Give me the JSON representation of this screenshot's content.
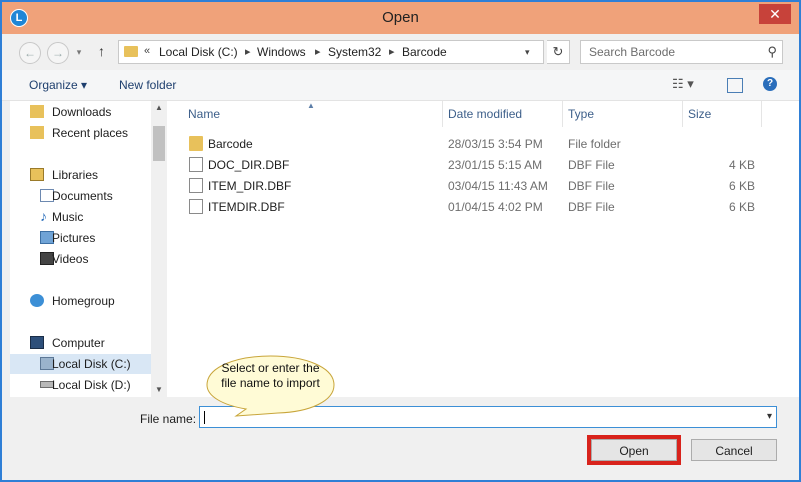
{
  "window": {
    "title": "Open",
    "close_label": "✕",
    "app_icon": "L"
  },
  "navigation": {
    "back_glyph": "←",
    "forward_glyph": "→",
    "up_glyph": "↑",
    "breadcrumb": [
      "Local Disk (C:)",
      "Windows",
      "System32",
      "Barcode"
    ],
    "overflow": "«",
    "refresh_glyph": "↻"
  },
  "search": {
    "placeholder": "Search Barcode",
    "icon": "search-icon"
  },
  "toolbar": {
    "organize_label": "Organize ▾",
    "new_folder_label": "New folder",
    "view_glyph": "☷ ▾",
    "help_glyph": "?"
  },
  "sidebar": {
    "items": [
      {
        "label": "Downloads",
        "icon": "downloads-icon"
      },
      {
        "label": "Recent places",
        "icon": "recent-places-icon"
      },
      {
        "label": "Libraries",
        "icon": "libraries-icon"
      },
      {
        "label": "Documents",
        "icon": "documents-icon"
      },
      {
        "label": "Music",
        "icon": "music-icon"
      },
      {
        "label": "Pictures",
        "icon": "pictures-icon"
      },
      {
        "label": "Videos",
        "icon": "videos-icon"
      },
      {
        "label": "Homegroup",
        "icon": "homegroup-icon"
      },
      {
        "label": "Computer",
        "icon": "computer-icon"
      },
      {
        "label": "Local Disk (C:)",
        "icon": "drive-c-icon",
        "selected": true
      },
      {
        "label": "Local Disk (D:)",
        "icon": "drive-d-icon"
      }
    ]
  },
  "columns": {
    "name": "Name",
    "date": "Date modified",
    "type": "Type",
    "size": "Size"
  },
  "files": [
    {
      "name": "Barcode",
      "date": "28/03/15 3:54 PM",
      "type": "File folder",
      "size": "",
      "kind": "folder"
    },
    {
      "name": "DOC_DIR.DBF",
      "date": "23/01/15 5:15 AM",
      "type": "DBF File",
      "size": "4 KB",
      "kind": "file"
    },
    {
      "name": "ITEM_DIR.DBF",
      "date": "03/04/15 11:43 AM",
      "type": "DBF File",
      "size": "6 KB",
      "kind": "file"
    },
    {
      "name": "ITEMDIR.DBF",
      "date": "01/04/15 4:02 PM",
      "type": "DBF File",
      "size": "6 KB",
      "kind": "file"
    }
  ],
  "footer": {
    "file_name_label": "File name:",
    "file_name_value": "",
    "open_label": "Open",
    "cancel_label": "Cancel"
  },
  "callout": {
    "text": "Select or enter the file name to import"
  },
  "colors": {
    "titlebar": "#f0a27a",
    "border": "#2f7fd6",
    "highlight": "#d8231c",
    "callout_fill": "#fffbd6",
    "callout_stroke": "#c8a53a"
  }
}
